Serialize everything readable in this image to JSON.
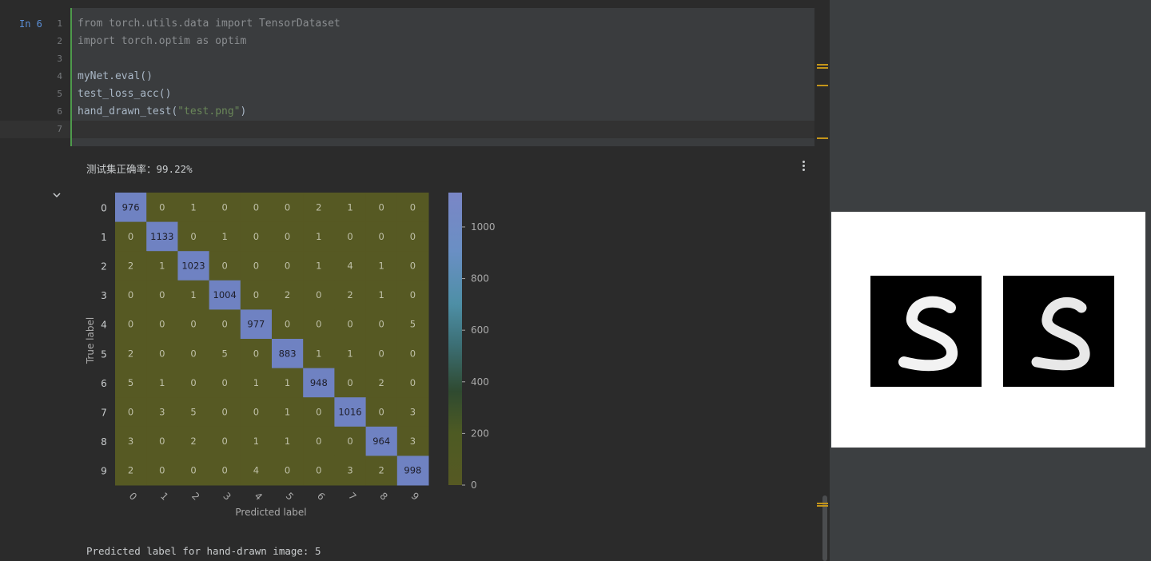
{
  "cell": {
    "execution_count": "In 6",
    "line_numbers": [
      "1",
      "2",
      "3",
      "4",
      "5",
      "6",
      "7"
    ],
    "code": {
      "l1": "from torch.utils.data import TensorDataset",
      "l2": "import torch.optim as optim",
      "l4": "myNet.eval()",
      "l5": "test_loss_acc()",
      "l6_fn": "hand_drawn_test(",
      "l6_str": "\"test.png\"",
      "l6_end": ")"
    }
  },
  "output": {
    "accuracy_text": "测试集正确率：99.22%",
    "prediction_text": "Predicted label for hand-drawn image: 5"
  },
  "icons": {
    "more": "more-vertical-icon",
    "collapse": "chevron-down-icon"
  },
  "colors": {
    "accent_bar": "#4e9a4b",
    "exec_count": "#5b8fd6",
    "marker": "#c4951a"
  },
  "chart_data": {
    "type": "heatmap",
    "xlabel": "Predicted label",
    "ylabel": "True label",
    "x_tick_labels": [
      "0",
      "1",
      "2",
      "3",
      "4",
      "5",
      "6",
      "7",
      "8",
      "9"
    ],
    "y_tick_labels": [
      "0",
      "1",
      "2",
      "3",
      "4",
      "5",
      "6",
      "7",
      "8",
      "9"
    ],
    "matrix": [
      [
        976,
        0,
        1,
        0,
        0,
        0,
        2,
        1,
        0,
        0
      ],
      [
        0,
        1133,
        0,
        1,
        0,
        0,
        1,
        0,
        0,
        0
      ],
      [
        2,
        1,
        1023,
        0,
        0,
        0,
        1,
        4,
        1,
        0
      ],
      [
        0,
        0,
        1,
        1004,
        0,
        2,
        0,
        2,
        1,
        0
      ],
      [
        0,
        0,
        0,
        0,
        977,
        0,
        0,
        0,
        0,
        5
      ],
      [
        2,
        0,
        0,
        5,
        0,
        883,
        1,
        1,
        0,
        0
      ],
      [
        5,
        1,
        0,
        0,
        1,
        1,
        948,
        0,
        2,
        0
      ],
      [
        0,
        3,
        5,
        0,
        0,
        1,
        0,
        1016,
        0,
        3
      ],
      [
        3,
        0,
        2,
        0,
        1,
        1,
        0,
        0,
        964,
        3
      ],
      [
        2,
        0,
        0,
        0,
        4,
        0,
        0,
        3,
        2,
        998
      ]
    ],
    "colorbar": {
      "ticks": [
        0,
        200,
        400,
        600,
        800,
        1000
      ],
      "tick_labels": [
        "0",
        "200",
        "400",
        "600",
        "800",
        "1000"
      ],
      "range": [
        0,
        1133
      ]
    }
  }
}
